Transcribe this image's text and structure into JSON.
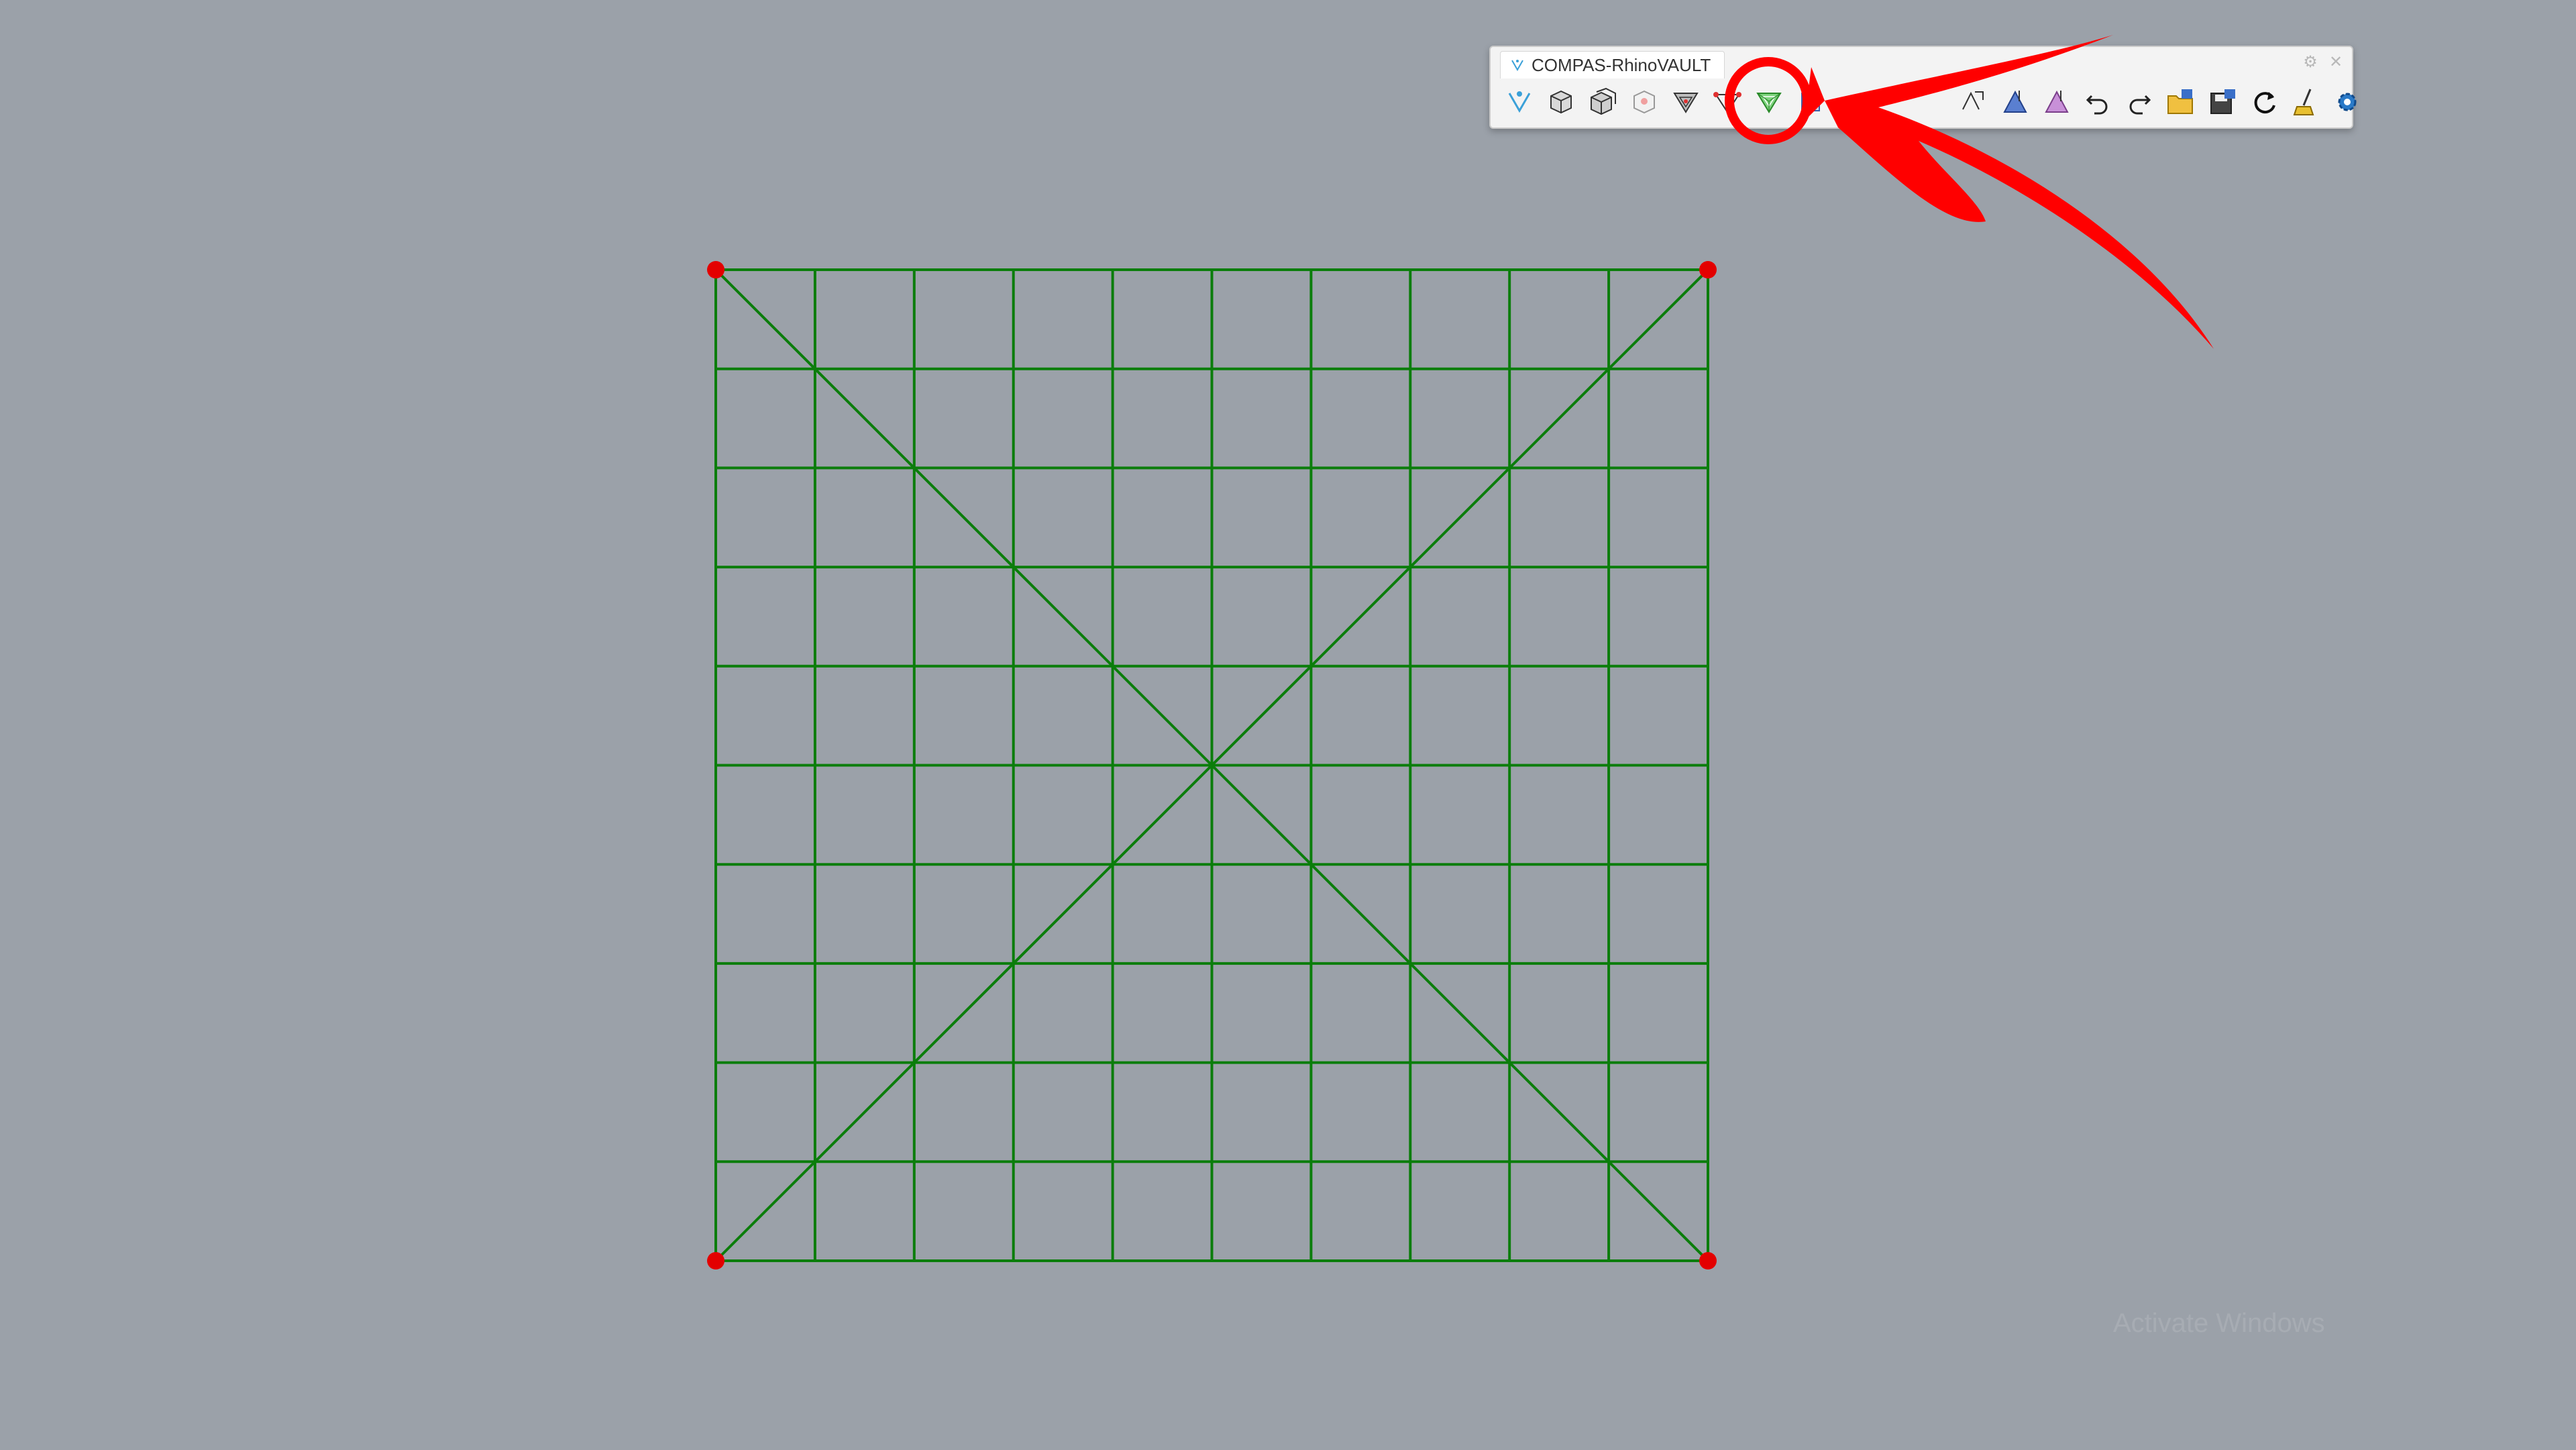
{
  "toolbar": {
    "title": "COMPAS-RhinoVAULT",
    "buttons": [
      {
        "name": "rv-init-icon"
      },
      {
        "name": "pattern-box-icon"
      },
      {
        "name": "pattern-boxes-icon"
      },
      {
        "name": "boundary-icon"
      },
      {
        "name": "form-diagram-icon"
      },
      {
        "name": "supports-icon"
      },
      {
        "name": "form-green-icon",
        "highlighted": true
      },
      {
        "name": "force-diagram-icon"
      },
      {
        "name": "modify-form-icon"
      },
      {
        "name": "modify-force-icon"
      },
      {
        "name": "modify-thrust-icon"
      },
      {
        "name": "undo-icon"
      },
      {
        "name": "redo-icon"
      },
      {
        "name": "open-file-icon"
      },
      {
        "name": "save-file-icon"
      },
      {
        "name": "reload-icon"
      },
      {
        "name": "clean-icon"
      },
      {
        "name": "settings-gear-icon"
      }
    ]
  },
  "mesh": {
    "divisions": 10,
    "color": "#0b7d0b",
    "support_color": "#e30000"
  },
  "annotation": {
    "color": "#ff0000",
    "target": "form-green-icon"
  },
  "watermark": "Activate Windows"
}
